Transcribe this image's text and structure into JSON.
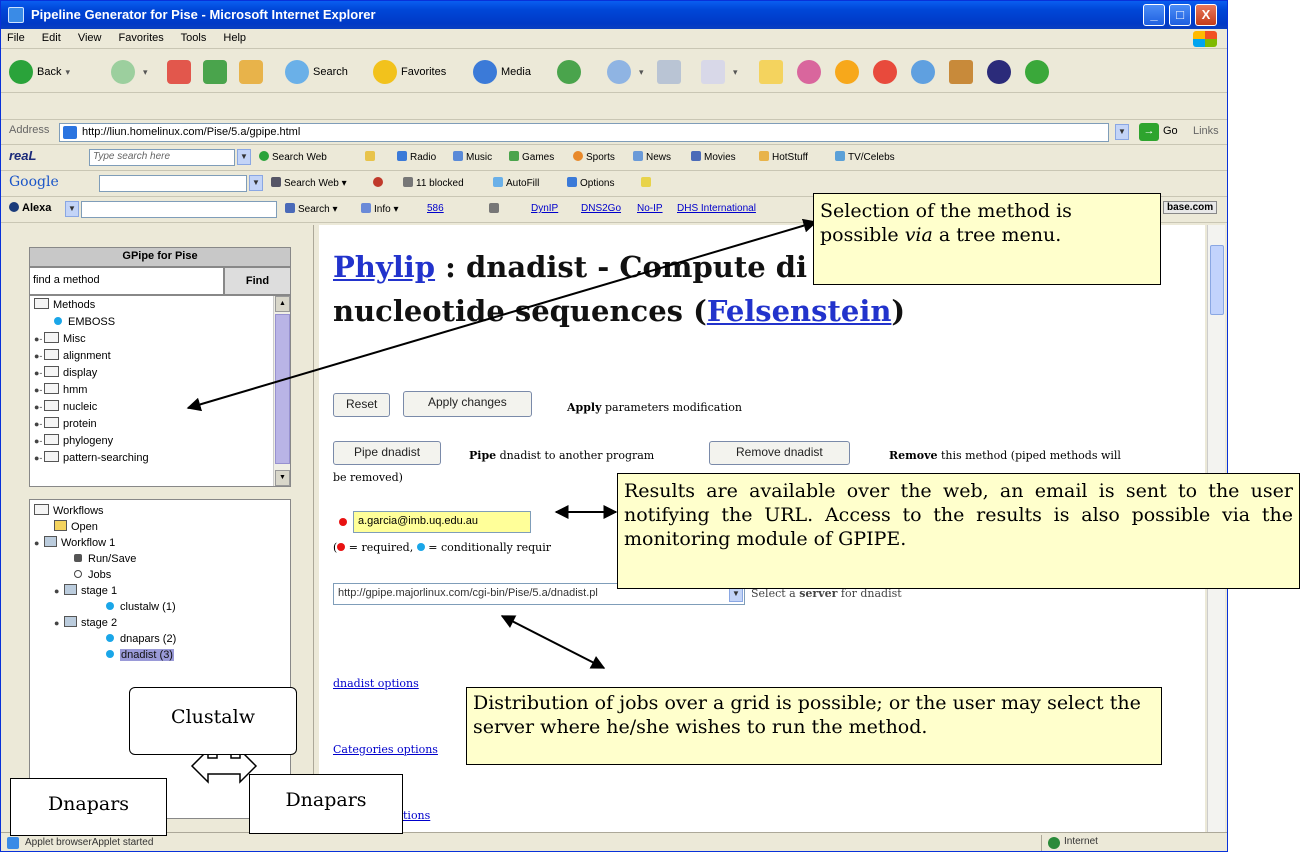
{
  "window": {
    "title": "Pipeline Generator for Pise - Microsoft Internet Explorer",
    "controls": {
      "minimize": "_",
      "maximize": "□",
      "close": "X"
    }
  },
  "menu": {
    "items": [
      "File",
      "Edit",
      "View",
      "Favorites",
      "Tools",
      "Help"
    ]
  },
  "toolbar": {
    "back": "Back",
    "search": "Search",
    "favorites": "Favorites",
    "media": "Media"
  },
  "address": {
    "label": "Address",
    "url": "http://liun.homelinux.com/Pise/5.a/gpipe.html",
    "go": "Go",
    "links": "Links"
  },
  "yahoo_bar": {
    "logo": "reaL",
    "search_placeholder": "Type search here",
    "search_web": "Search Web",
    "items": [
      "Radio",
      "Music",
      "Games",
      "Sports",
      "News",
      "Movies",
      "HotStuff",
      "TV/Celebs"
    ]
  },
  "google_bar": {
    "logo": "Google",
    "search_web": "Search Web",
    "blocked": "11 blocked",
    "autofill": "AutoFill",
    "options": "Options"
  },
  "alexa_bar": {
    "logo": "Alexa",
    "search": "Search",
    "info": "Info",
    "rank": "586",
    "links": [
      "DynIP",
      "DNS2Go",
      "No-IP",
      "DHS International"
    ],
    "right_badge": "base.com"
  },
  "left_panel": {
    "header": "GPipe for Pise",
    "find_placeholder": "find a method",
    "find_button": "Find",
    "methods_tree": [
      {
        "label": "Methods",
        "kind": "root"
      },
      {
        "label": "EMBOSS",
        "kind": "leaf"
      },
      {
        "label": "Misc",
        "kind": "folder"
      },
      {
        "label": "alignment",
        "kind": "folder"
      },
      {
        "label": "display",
        "kind": "folder"
      },
      {
        "label": "hmm",
        "kind": "folder"
      },
      {
        "label": "nucleic",
        "kind": "folder"
      },
      {
        "label": "protein",
        "kind": "folder"
      },
      {
        "label": "phylogeny",
        "kind": "folder"
      },
      {
        "label": "pattern-searching",
        "kind": "folder"
      }
    ],
    "workflows_tree": [
      {
        "label": "Workflows",
        "indent": 0
      },
      {
        "label": "Open",
        "indent": 1
      },
      {
        "label": "Workflow 1",
        "indent": 0
      },
      {
        "label": "Run/Save",
        "indent": 2
      },
      {
        "label": "Jobs",
        "indent": 2
      },
      {
        "label": "stage 1",
        "indent": 1
      },
      {
        "label": "clustalw (1)",
        "indent": 3
      },
      {
        "label": "stage 2",
        "indent": 1
      },
      {
        "label": "dnapars (2)",
        "indent": 3
      },
      {
        "label": "dnadist (3)",
        "indent": 3,
        "selected": true
      }
    ]
  },
  "content": {
    "title_link1": "Phylip",
    "title_text1": " : dnadist - Compute di",
    "title_text2": "nucleotide sequences (",
    "title_link2": "Felsenstein",
    "title_close": ")",
    "reset_button": "Reset",
    "apply_button": "Apply changes",
    "apply_bold": "Apply",
    "apply_text": " parameters modification",
    "pipe_button": "Pipe dnadist",
    "pipe_bold": "Pipe",
    "pipe_text": " dnadist to another program",
    "remove_button": "Remove dnadist",
    "remove_bold": "Remove",
    "remove_text": " this method (piped methods will",
    "remove_text2": "be removed)",
    "email_value": "a.garcia@imb.uq.edu.au",
    "legend_required": " = required, ",
    "legend_conditional": " = conditionally requir",
    "server_value": "http://gpipe.majorlinux.com/cgi-bin/Pise/5.a/dnadist.pl",
    "server_label_pre": "Select a ",
    "server_label_bold": "server",
    "server_label_post": " for dnadist",
    "opt_links": [
      "dnadist options",
      "Categories options",
      "tions"
    ]
  },
  "callouts": {
    "tree_menu_pre": "Selection of the method is possible ",
    "tree_menu_italic": "via",
    "tree_menu_post": " a tree menu.",
    "results": "Results are available over the web, an email is sent to the user notifying the URL. Access to the results is also possible via the monitoring module of GPIPE.",
    "grid": "Distribution of jobs over a grid is possible; or the user may select the server where he/she wishes to run the method."
  },
  "labels": {
    "clustalw": "Clustalw",
    "dnapars_left": "Dnapars",
    "dnapars_right": "Dnapars"
  },
  "status": {
    "text": "Applet browserApplet started",
    "zone": "Internet"
  },
  "colors": {
    "title_bar": "#0047d8",
    "link": "#2233cc",
    "callout_bg": "#ffffcc",
    "email_bg": "#ffff99",
    "required_dot": "#e81212",
    "conditional_dot": "#1aa6e8"
  }
}
